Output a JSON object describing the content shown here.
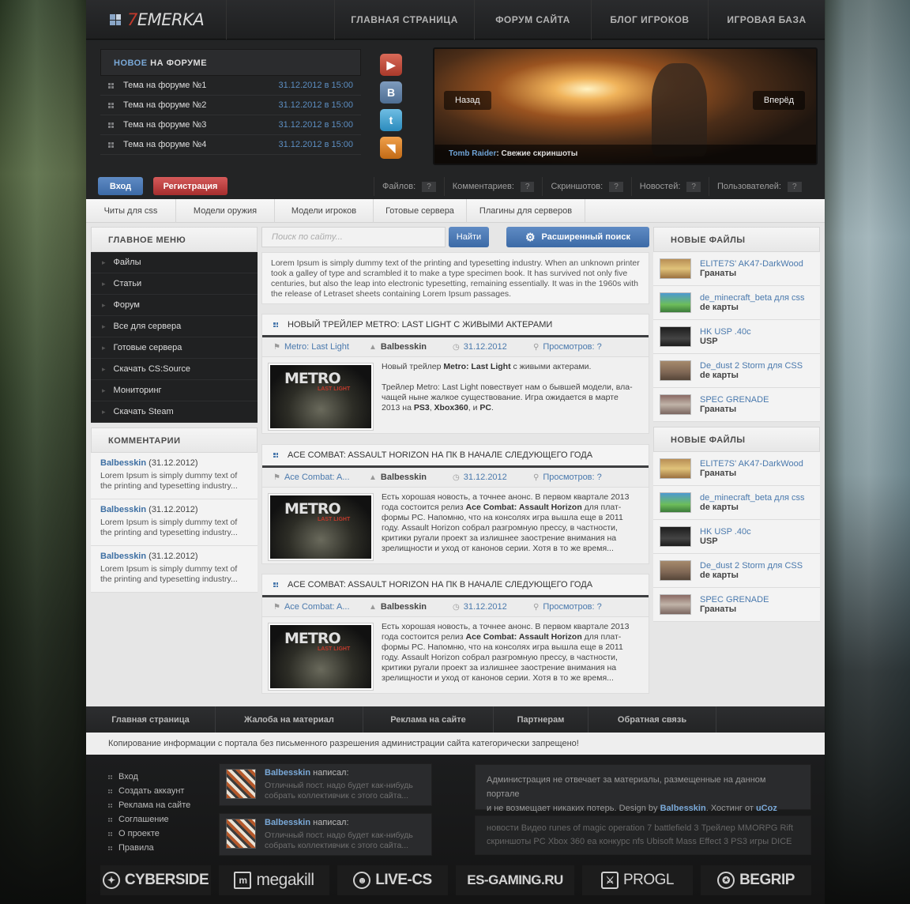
{
  "logo": {
    "accent": "7",
    "text": "EMERKA"
  },
  "topnav": [
    "ГЛАВНАЯ СТРАНИЦА",
    "ФОРУМ САЙТА",
    "БЛОГ ИГРОКОВ",
    "ИГРОВАЯ БАЗА"
  ],
  "forum": {
    "title_accent": "НОВОЕ",
    "title_rest": " НА ФОРУМЕ",
    "items": [
      {
        "title": "Тема на форуме №1",
        "date": "31.12.2012 в 15:00"
      },
      {
        "title": "Тема на форуме №2",
        "date": "31.12.2012 в 15:00"
      },
      {
        "title": "Тема на форуме №3",
        "date": "31.12.2012 в 15:00"
      },
      {
        "title": "Тема на форуме №4",
        "date": "31.12.2012 в 15:00"
      }
    ]
  },
  "social": {
    "youtube": "youtube-icon",
    "vk": "vk-icon",
    "twitter": "twitter-icon",
    "rss": "rss-icon"
  },
  "slider": {
    "prev": "Назад",
    "next": "Вперёд",
    "caption_game": "Tomb Raider",
    "caption_text": ": Свежие скриншоты"
  },
  "auth": {
    "login": "Вход",
    "register": "Регистрация"
  },
  "stats": [
    {
      "label": "Файлов:",
      "value": "?"
    },
    {
      "label": "Комментариев:",
      "value": "?"
    },
    {
      "label": "Скриншотов:",
      "value": "?"
    },
    {
      "label": "Новостей:",
      "value": "?"
    },
    {
      "label": "Пользователей:",
      "value": "?"
    }
  ],
  "categories": [
    "Читы для css",
    "Модели оружия",
    "Модели игроков",
    "Готовые сервера",
    "Плагины для серверов"
  ],
  "main_menu": {
    "title": "ГЛАВНОЕ МЕНЮ",
    "items": [
      "Файлы",
      "Статьи",
      "Форум",
      "Все для сервера",
      "Готовые сервера",
      "Скачать CS:Source",
      "Мониторинг",
      "Скачать Steam"
    ]
  },
  "comments": {
    "title": "КОММЕНТАРИИ",
    "items": [
      {
        "user": "Balbesskin",
        "date": " (31.12.2012)",
        "line1": "Lorem Ipsum is simply dummy text of",
        "line2": "the printing and typesetting industry..."
      },
      {
        "user": "Balbesskin",
        "date": " (31.12.2012)",
        "line1": "Lorem Ipsum is simply dummy text of",
        "line2": "the printing and typesetting industry..."
      },
      {
        "user": "Balbesskin",
        "date": " (31.12.2012)",
        "line1": "Lorem Ipsum is simply dummy text of",
        "line2": "the printing and typesetting industry..."
      }
    ]
  },
  "search": {
    "placeholder": "Поиск по сайту...",
    "button": "Найти",
    "advanced": "Расширенный поиск"
  },
  "intro": "Lorem Ipsum is simply dummy text of the printing and typesetting industry. When an unknown printer took a galley of type and scrambled it to make a type specimen book. It has survived not only five centuries, but also the leap into electronic typesetting, remaining essentially. It was in the 1960s with the release of Letraset sheets containing Lorem Ipsum passages.",
  "posts": [
    {
      "title": "НОВЫЙ ТРЕЙЛЕР METRO: LAST LIGHT С ЖИВЫМИ АКТЕРАМИ",
      "category": "Metro: Last Light",
      "author": "Balbesskin",
      "date": "31.12.2012",
      "views": "Просмотров: ?",
      "thumb_title": "METRO",
      "thumb_sub": "LAST LIGHT",
      "p1_a": "Новый трейлер ",
      "p1_b": "Metro: Last Light",
      "p1_c": " с живыми актерами.",
      "p2_a": "Трейлер Metro: Last Light повествует нам о бывшей модели, вла-",
      "p2_b": "чащей ныне жалкое существование. Игра ожидается в марте",
      "p2_c": "2013 на ",
      "p2_d": "PS3",
      "p2_e": ", ",
      "p2_f": "Xbox360",
      "p2_g": ", и ",
      "p2_h": "PC",
      "p2_i": "."
    },
    {
      "title": "ACE COMBAT: ASSAULT HORIZON НА ПК В НАЧАЛЕ СЛЕДУЮЩЕГО ГОДА",
      "category": "Ace Combat: A...",
      "author": "Balbesskin",
      "date": "31.12.2012",
      "views": "Просмотров: ?",
      "thumb_title": "METRO",
      "thumb_sub": "LAST LIGHT",
      "t1": "Есть хорошая новость, а точнее анонс. В первом квартале 2013",
      "t2a": "года состоится релиз ",
      "t2b": "Ace Combat: Assault Horizon",
      "t2c": " для плат-",
      "t3": "формы PC. Напомню, что на консолях игра вышла еще в 2011",
      "t4": "году. Assault Horizon собрал разгромную прессу, в частности,",
      "t5": "критики ругали проект за излишнее заострение внимания на",
      "t6": "зрелищности и уход от канонов серии. Хотя в то же время..."
    },
    {
      "title": "ACE COMBAT: ASSAULT HORIZON НА ПК В НАЧАЛЕ СЛЕДУЮЩЕГО ГОДА",
      "category": "Ace Combat: A...",
      "author": "Balbesskin",
      "date": "31.12.2012",
      "views": "Просмотров: ?",
      "thumb_title": "METRO",
      "thumb_sub": "LAST LIGHT",
      "t1": "Есть хорошая новость, а точнее анонс. В первом квартале 2013",
      "t2a": "года состоится релиз ",
      "t2b": "Ace Combat: Assault Horizon",
      "t2c": " для плат-",
      "t3": "формы PC. Напомню, что на консолях игра вышла еще в 2011",
      "t4": "году. Assault Horizon собрал разгромную прессу, в частности,",
      "t5": "критики ругали проект за излишнее заострение внимания на",
      "t6": "зрелищности и уход от канонов серии. Хотя в то же время..."
    }
  ],
  "new_files": {
    "title": "НОВЫЕ ФАЙЛЫ",
    "items": [
      {
        "name": "ELITE7S' AK47-DarkWood",
        "type": "Гранаты"
      },
      {
        "name": "de_minecraft_beta для css",
        "type": "de карты"
      },
      {
        "name": "HK USP .40c",
        "type": "USP"
      },
      {
        "name": "De_dust 2 Storm для CSS",
        "type": "de карты"
      },
      {
        "name": "SPEC GRENADE",
        "type": "Гранаты"
      }
    ]
  },
  "new_files_2": {
    "title": "НОВЫЕ ФАЙЛЫ",
    "items": [
      {
        "name": "ELITE7S' AK47-DarkWood",
        "type": "Гранаты"
      },
      {
        "name": "de_minecraft_beta для css",
        "type": "de карты"
      },
      {
        "name": "HK USP .40c",
        "type": "USP"
      },
      {
        "name": "De_dust 2 Storm для CSS",
        "type": "de карты"
      },
      {
        "name": "SPEC GRENADE",
        "type": "Гранаты"
      }
    ]
  },
  "footer_nav": [
    "Главная страница",
    "Жалоба на материал",
    "Реклама на сайте",
    "Партнерам",
    "Обратная связь"
  ],
  "copyright": "Копирование информации с портала без письменного разрешения администрации сайта категорически запрещено!",
  "footer_links": [
    "Вход",
    "Создать аккаунт",
    "Реклама на сайте",
    "Соглашение",
    "О проекте",
    "Правила"
  ],
  "footer_comments": [
    {
      "user": "Balbesskin",
      "action": " написал:",
      "line1": "Отличный пост. надо будет как-нибудь",
      "line2": "собрать коллективчик с этого сайта..."
    },
    {
      "user": "Balbesskin",
      "action": " написал:",
      "line1": "Отличный пост. надо будет как-нибудь",
      "line2": "собрать коллективчик с этого сайта..."
    }
  ],
  "footer_info": {
    "line1": "Администрация не отвечает за материалы, размещенные на данном портале",
    "line2a": "и не возмещает никаких потерь. Design by ",
    "designer": "Balbesskin",
    "line2b": ". Хостинг от ",
    "host": "uCoz"
  },
  "tags": {
    "line1": "новости Видео runes of magic operation 7 battlefield 3 Трейлер MMORPG Rift",
    "line2": "скриншоты PC Xbox 360 ea конкурс nfs Ubisoft Mass Effect 3 PS3 игры DICE"
  },
  "partners": [
    "CYBERSIDE",
    "megakill",
    "LIVE-CS",
    "ES-GAMING.RU",
    "PROGL",
    "BEGRIP"
  ],
  "colors": {
    "accent_blue": "#3c6aa6",
    "accent_red": "#c0392b",
    "link_blue": "#4a79ad"
  }
}
